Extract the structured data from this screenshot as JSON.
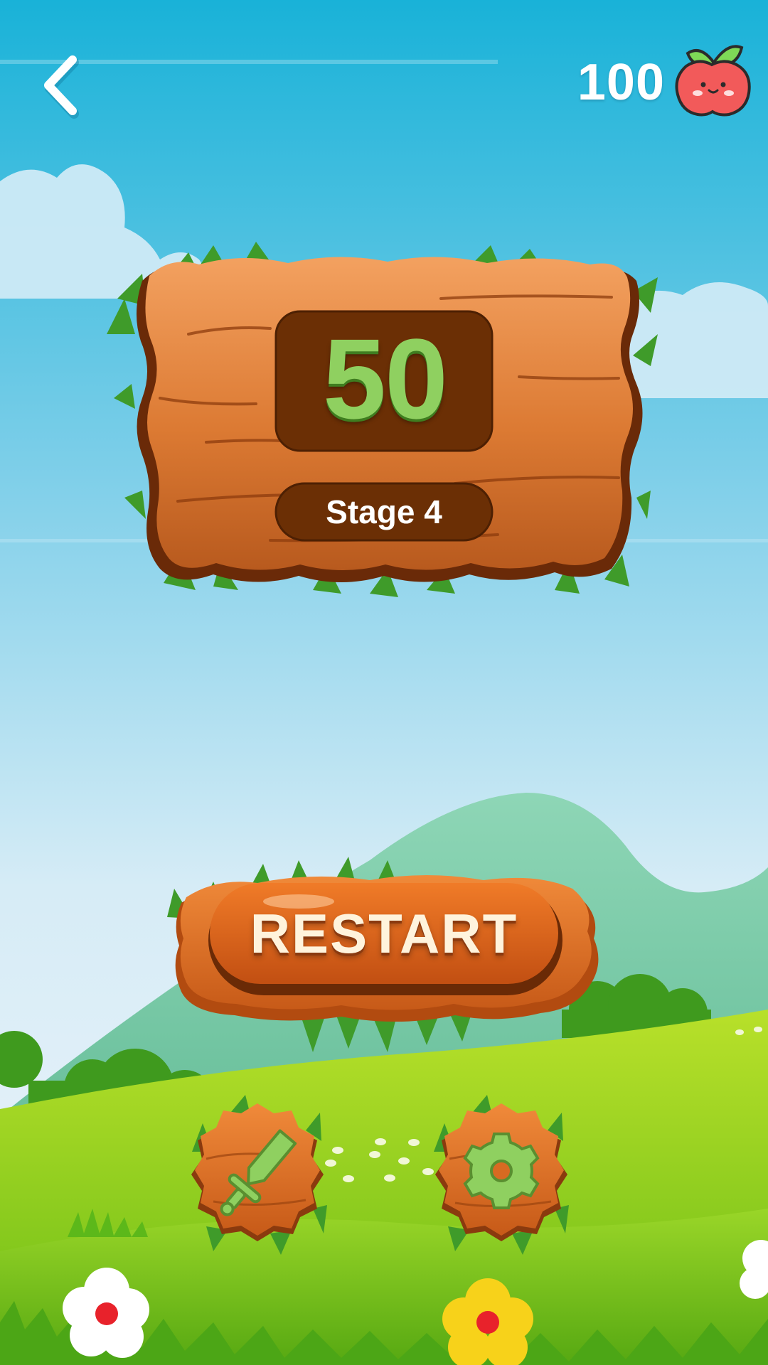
{
  "hud": {
    "coins": "100",
    "back_icon": "chevron-left-icon",
    "currency_icon": "apple-icon"
  },
  "scoreboard": {
    "score": "50",
    "stage": "Stage 4"
  },
  "actions": {
    "restart_label": "RESTART",
    "weapon_icon": "sword-icon",
    "settings_icon": "gear-icon"
  },
  "colors": {
    "sky_top": "#1bb0d8",
    "wood": "#e07a2e",
    "wood_dark": "#6e2f0c",
    "score_green": "#8fd060",
    "grass": "#7cc51a"
  }
}
